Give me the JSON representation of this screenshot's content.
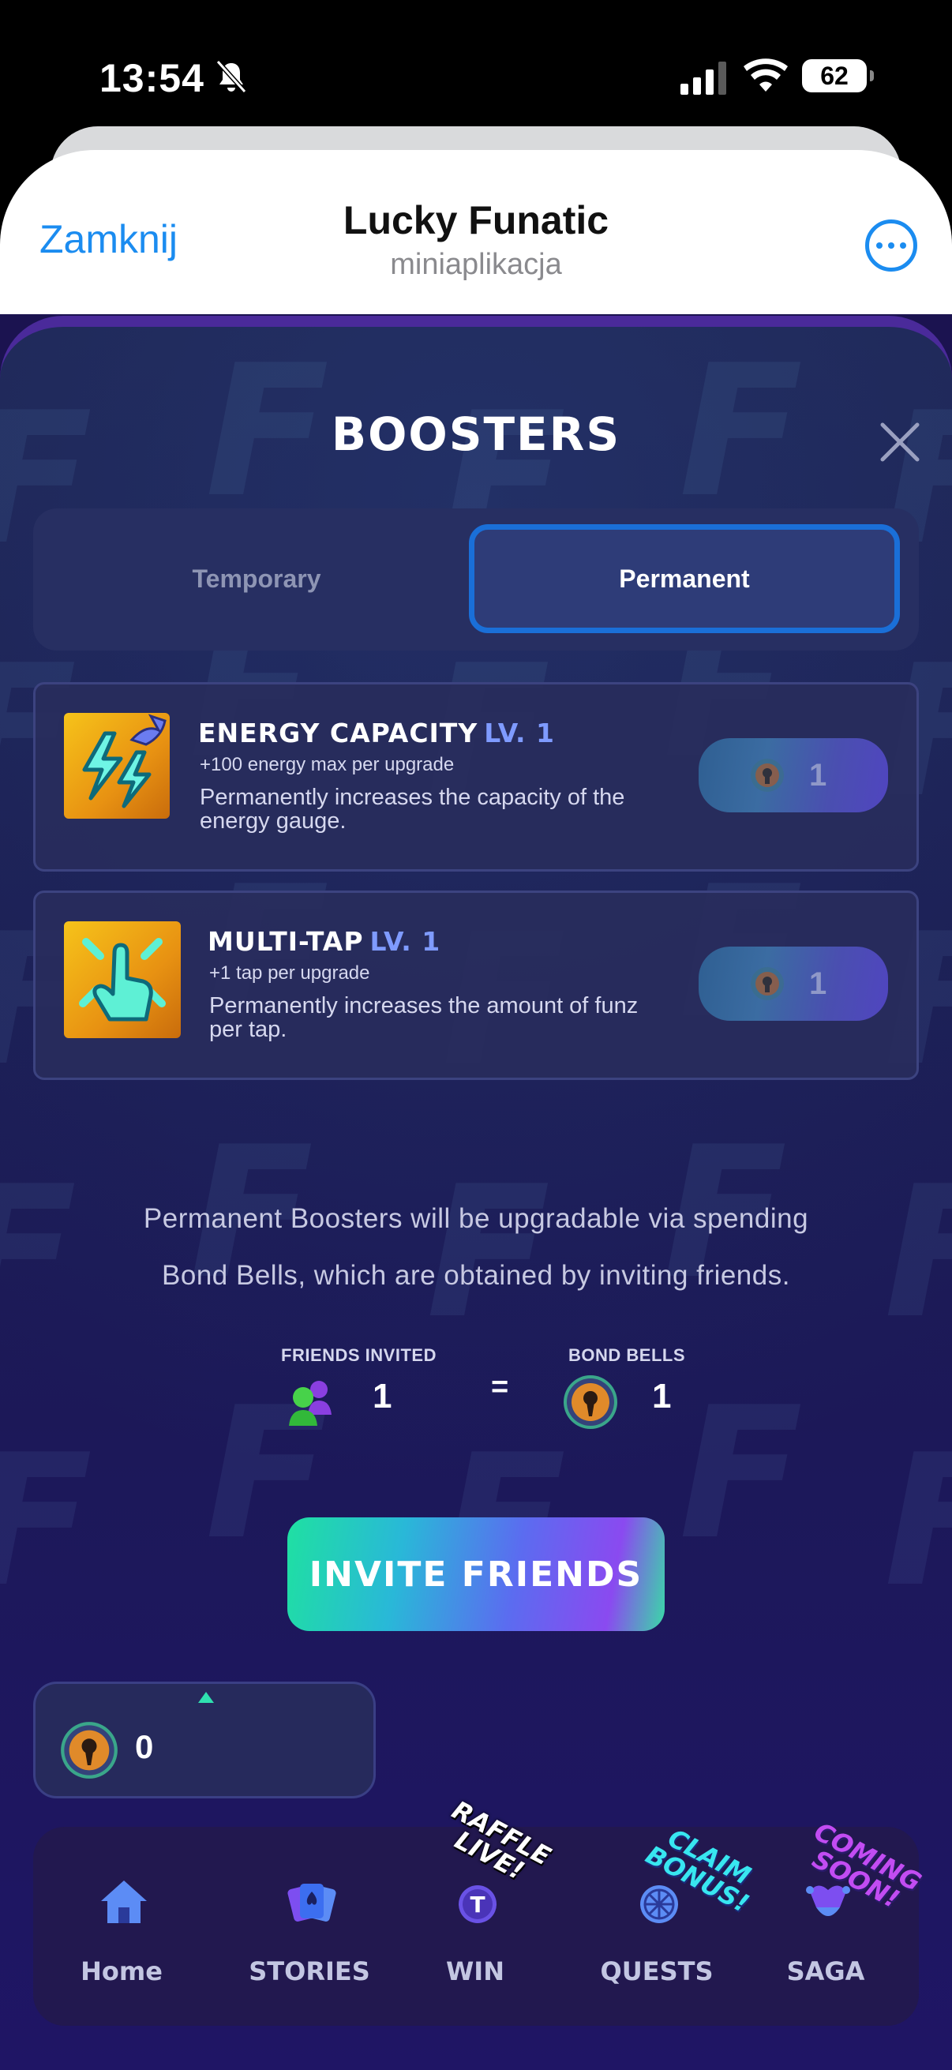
{
  "status_bar": {
    "time": "13:54",
    "battery": "62",
    "icons": [
      "bell-slash-icon",
      "cellular-signal-icon",
      "wifi-icon",
      "battery-icon"
    ]
  },
  "app_header": {
    "close_label": "Zamknij",
    "title": "Lucky Funatic",
    "subtitle": "miniaplikacja",
    "more_icon": "ellipsis-circle-icon",
    "accent_color": "#1b8cf0"
  },
  "boosters": {
    "title": "BOOSTERS",
    "tabs": [
      {
        "label": "Temporary",
        "selected": false
      },
      {
        "label": "Permanent",
        "selected": true
      }
    ],
    "items": [
      {
        "name": "ENERGY CAPACITY",
        "level": "LV. 1",
        "subtitle": "+100 energy max per upgrade",
        "description": "Permanently increases the capacity of the energy gauge.",
        "cost": "1",
        "icon": "lightning-bolt-icon"
      },
      {
        "name": "MULTI-TAP",
        "level": "LV. 1",
        "subtitle": "+1 tap per upgrade",
        "description": "Permanently increases the amount of funz per tap.",
        "cost": "1",
        "icon": "tap-hand-icon"
      }
    ],
    "info_line1": "Permanent Boosters will be upgradable via spending",
    "info_line2": "Bond Bells, which are obtained by inviting friends.",
    "friends_invited_label": "FRIENDS INVITED",
    "friends_invited_value": "1",
    "equals": "=",
    "bond_bells_label": "BOND BELLS",
    "bond_bells_value": "1",
    "invite_button": "INVITE FRIENDS"
  },
  "wallet": {
    "balance": "0"
  },
  "nav": {
    "items": [
      {
        "label": "Home",
        "icon": "home-icon"
      },
      {
        "label": "STORIES",
        "icon": "cards-icon"
      },
      {
        "label": "WIN",
        "icon": "token-icon"
      },
      {
        "label": "QUESTS",
        "icon": "wheel-icon"
      },
      {
        "label": "SAGA",
        "icon": "jester-icon"
      }
    ],
    "badge_raffle_line1": "RAFFLE",
    "badge_raffle_line2": "LIVE!",
    "badge_claim_line1": "CLAIM",
    "badge_claim_line2": "BONUS!",
    "badge_soon_line1": "COMING",
    "badge_soon_line2": "SOON!"
  }
}
